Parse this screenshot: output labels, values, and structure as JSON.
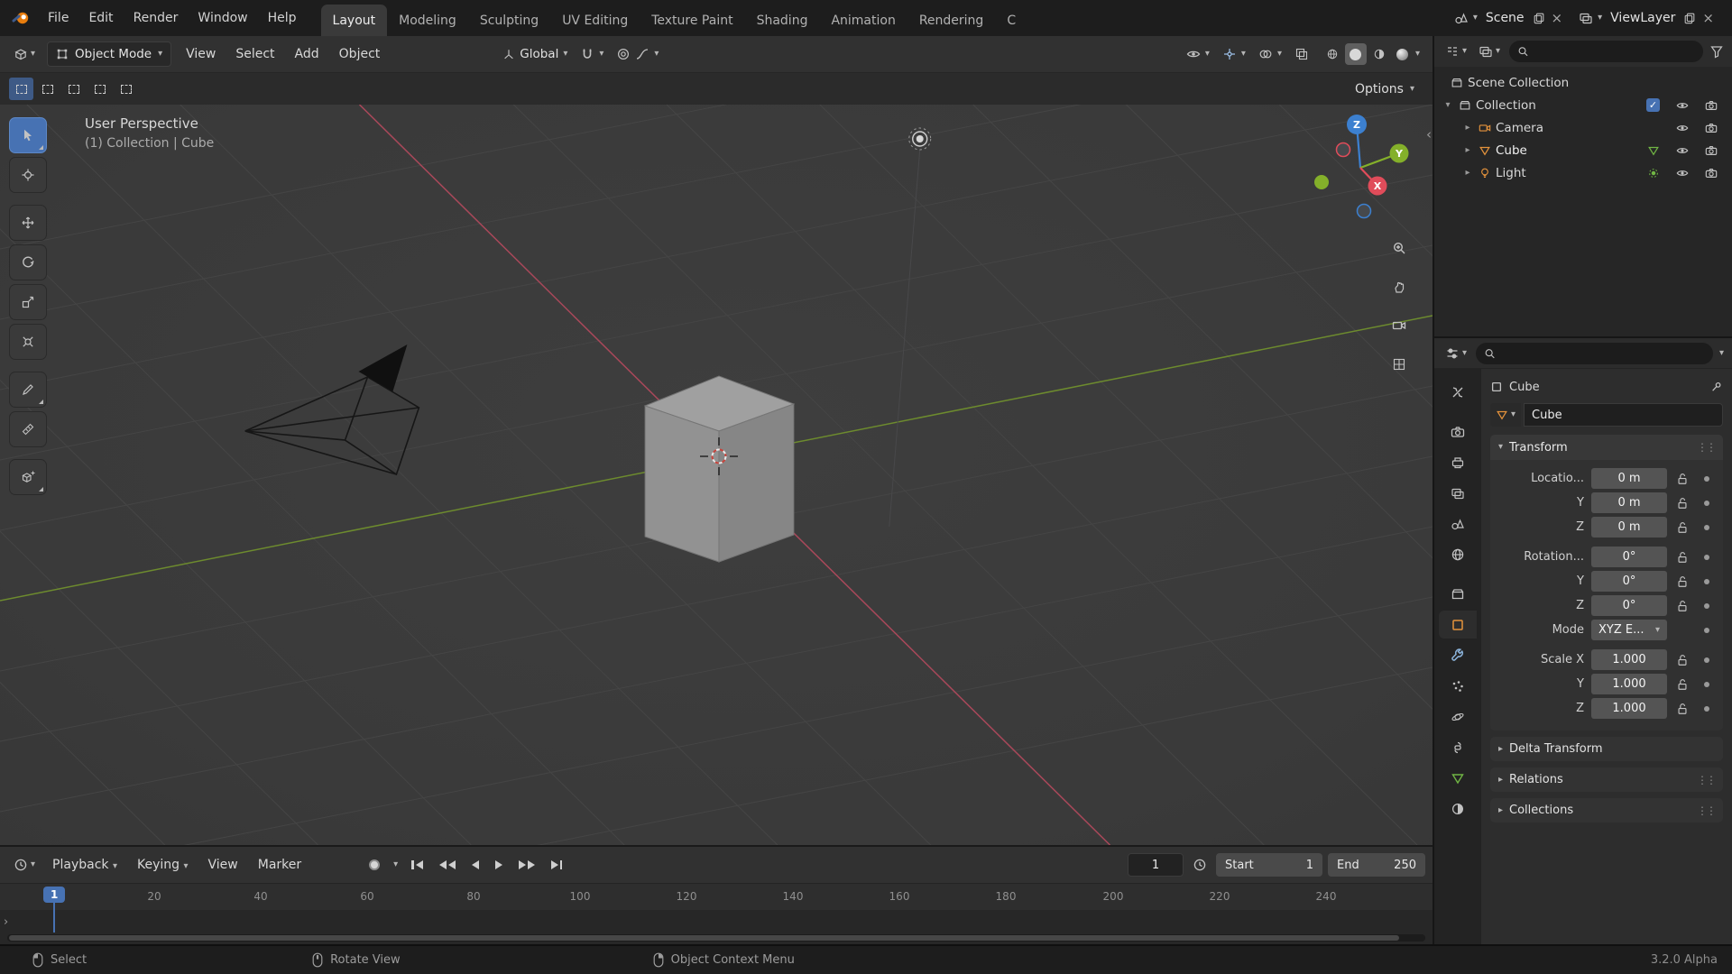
{
  "colors": {
    "bar_bg": "#1d1d1d",
    "header_bg": "#313131",
    "tools_bg": "#2b2b2b",
    "viewport_bg": "#3b3b3b",
    "outliner_bg": "#262626",
    "props_bg": "#2d2d2d",
    "tabstrip_bg": "#232323",
    "field": "#545454",
    "accent": "#4772b3",
    "object_orange": "#e5933c",
    "data_green": "#70b544",
    "axis_x": "#a9485a",
    "axis_y": "#6d8b2e",
    "gizmo_x": "#e04c5a",
    "gizmo_y": "#84b02a",
    "gizmo_z": "#3c80d0",
    "text": "#d4d4d4"
  },
  "icons": {
    "chevron_down": "▾",
    "disclosure_open": "▾",
    "disclosure_closed": "▸",
    "check": "✓",
    "close": "×",
    "collapse_left": "‹",
    "expand_right": "›",
    "drag_dots": "⋮⋮"
  },
  "topbar": {
    "menus": [
      "File",
      "Edit",
      "Render",
      "Window",
      "Help"
    ],
    "workspaces": [
      "Layout",
      "Modeling",
      "Sculpting",
      "UV Editing",
      "Texture Paint",
      "Shading",
      "Animation",
      "Rendering",
      "C"
    ],
    "scene_label": "Scene",
    "view_layer_label": "ViewLayer"
  },
  "viewport_header": {
    "mode": "Object Mode",
    "menus": [
      "View",
      "Select",
      "Add",
      "Object"
    ],
    "orientation": "Global",
    "options_label": "Options"
  },
  "viewport": {
    "view_label": "User Perspective",
    "context_label": "(1) Collection | Cube",
    "gizmo_axes": {
      "x": "X",
      "y": "Y",
      "z": "Z"
    }
  },
  "outliner": {
    "rows": {
      "scene_collection": "Scene Collection",
      "collection": "Collection",
      "camera": "Camera",
      "cube": "Cube",
      "light": "Light"
    }
  },
  "properties": {
    "tabs": [
      "tool",
      "render",
      "output",
      "view-layer",
      "scene",
      "world",
      "collection",
      "object",
      "modifiers",
      "particles",
      "physics",
      "constraints",
      "object-data",
      "material"
    ],
    "active_tab": "object",
    "breadcrumb_object": "Cube",
    "name_value": "Cube",
    "transform_title": "Transform",
    "rows": {
      "loc_x": {
        "label": "Locatio...",
        "value": "0 m"
      },
      "loc_y": {
        "label": "Y",
        "value": "0 m"
      },
      "loc_z": {
        "label": "Z",
        "value": "0 m"
      },
      "rot_x": {
        "label": "Rotation...",
        "value": "0°"
      },
      "rot_y": {
        "label": "Y",
        "value": "0°"
      },
      "rot_z": {
        "label": "Z",
        "value": "0°"
      },
      "mode": {
        "label": "Mode",
        "value": "XYZ E..."
      },
      "scale_x": {
        "label": "Scale X",
        "value": "1.000"
      },
      "scale_y": {
        "label": "Y",
        "value": "1.000"
      },
      "scale_z": {
        "label": "Z",
        "value": "1.000"
      }
    },
    "collapsed_panels": [
      "Delta Transform",
      "Relations",
      "Collections"
    ]
  },
  "timeline": {
    "menus": [
      "Playback",
      "Keying",
      "View",
      "Marker"
    ],
    "current_frame": "1",
    "marker_frame": "1",
    "start_label": "Start",
    "start_value": "1",
    "end_label": "End",
    "end_value": "250",
    "ticks": [
      "20",
      "40",
      "60",
      "80",
      "100",
      "120",
      "140",
      "160",
      "180",
      "200",
      "220",
      "240"
    ]
  },
  "statusbar": {
    "hint_select": "Select",
    "hint_rotate": "Rotate View",
    "hint_context": "Object Context Menu",
    "version": "3.2.0 Alpha"
  }
}
